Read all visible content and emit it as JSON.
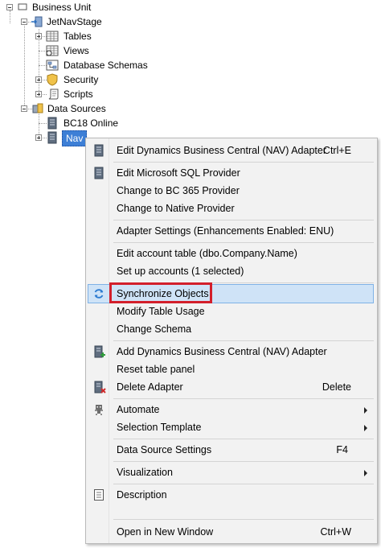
{
  "tree": {
    "business_unit": "Business Unit",
    "jetnavstage": "JetNavStage",
    "tables": "Tables",
    "views": "Views",
    "database_schemas": "Database Schemas",
    "security": "Security",
    "scripts": "Scripts",
    "data_sources": "Data Sources",
    "bc18_online": "BC18 Online",
    "nav": "Nav"
  },
  "menu": {
    "edit_dynamics_adapter": "Edit Dynamics Business Central (NAV) Adapter",
    "edit_dynamics_adapter_shortcut": "Ctrl+E",
    "edit_sql_provider": "Edit Microsoft SQL Provider",
    "change_bc365": "Change to BC 365 Provider",
    "change_native": "Change to Native Provider",
    "adapter_settings": "Adapter Settings (Enhancements Enabled: ENU)",
    "edit_account_table": "Edit account table (dbo.Company.Name)",
    "set_up_accounts": "Set up accounts (1 selected)",
    "synchronize_objects": "Synchronize Objects",
    "modify_table_usage": "Modify Table Usage",
    "change_schema": "Change Schema",
    "add_dynamics_adapter": "Add Dynamics Business Central (NAV) Adapter",
    "reset_table_panel": "Reset table panel",
    "delete_adapter": "Delete Adapter",
    "delete_shortcut": "Delete",
    "automate": "Automate",
    "selection_template": "Selection Template",
    "data_source_settings": "Data Source Settings",
    "data_source_settings_shortcut": "F4",
    "visualization": "Visualization",
    "description": "Description",
    "open_new_window": "Open in New Window",
    "open_new_window_shortcut": "Ctrl+W"
  },
  "colors": {
    "highlight": "#cfe3f7",
    "highlight_border": "#7fb2e6",
    "callout": "#d31f2b",
    "selected_node": "#3d7fd6"
  }
}
